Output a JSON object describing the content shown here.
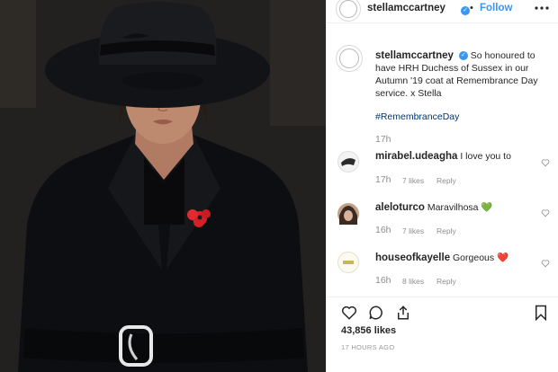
{
  "account": {
    "username": "stellamccartney",
    "follow_label": "Follow",
    "more_icon": "more-horizontal-icon"
  },
  "caption": {
    "text": "So honoured to have HRH Duchess of Sussex in our Autumn '19 coat at Remembrance Day service. x Stella",
    "hashtag": "#RemembranceDay",
    "time": "17h"
  },
  "comments": [
    {
      "username": "mirabel.udeagha",
      "text": "I love you to",
      "time": "17h",
      "likes": "7 likes",
      "reply": "Reply"
    },
    {
      "username": "aleloturco",
      "text": "Maravilhosa",
      "emoji": "💚",
      "time": "16h",
      "likes": "7 likes",
      "reply": "Reply"
    },
    {
      "username": "houseofkayelle",
      "text": "Gorgeous",
      "emoji": "❤️",
      "time": "16h",
      "likes": "8 likes",
      "reply": "Reply"
    }
  ],
  "post": {
    "likes": "43,856 likes",
    "posted": "17 HOURS AGO"
  },
  "colors": {
    "link_blue": "#3897f0",
    "hashtag_blue": "#003569",
    "muted": "#8e8e8e",
    "poppy_red": "#d71f28"
  }
}
